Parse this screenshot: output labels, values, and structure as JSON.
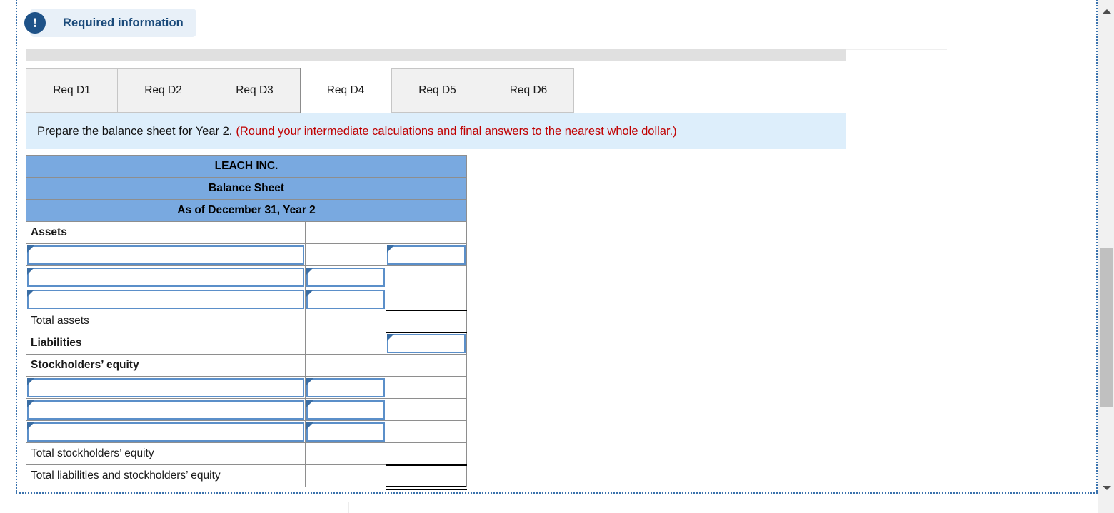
{
  "notice": {
    "icon": "exclamation-icon",
    "icon_glyph": "!",
    "label": "Required information"
  },
  "tabs": [
    {
      "label": "Req D1",
      "active": false
    },
    {
      "label": "Req D2",
      "active": false
    },
    {
      "label": "Req D3",
      "active": false
    },
    {
      "label": "Req D4",
      "active": true
    },
    {
      "label": "Req D5",
      "active": false
    },
    {
      "label": "Req D6",
      "active": false
    }
  ],
  "prompt": {
    "text": "Prepare the balance sheet for Year 2.",
    "note": "(Round your intermediate calculations and final answers to the nearest whole dollar.)",
    "note_color": "#c00000",
    "background": "#ddeefb"
  },
  "statement": {
    "header_background": "#79a9e0",
    "title_lines": [
      "LEACH INC.",
      "Balance Sheet",
      "As of December 31, Year 2"
    ],
    "rows": [
      {
        "label": "Assets",
        "mid": "",
        "right": ""
      },
      {
        "label": "",
        "mid": "",
        "right": ""
      },
      {
        "label": "",
        "mid": "",
        "right": ""
      },
      {
        "label": "",
        "mid": "",
        "right": ""
      },
      {
        "label": "Total assets",
        "mid": "",
        "right": ""
      },
      {
        "label": "Liabilities",
        "mid": "",
        "right": ""
      },
      {
        "label": "Stockholders’ equity",
        "mid": "",
        "right": ""
      },
      {
        "label": "",
        "mid": "",
        "right": ""
      },
      {
        "label": "",
        "mid": "",
        "right": ""
      },
      {
        "label": "",
        "mid": "",
        "right": ""
      },
      {
        "label": "Total stockholders’ equity",
        "mid": "",
        "right": ""
      },
      {
        "label": "Total liabilities and stockholders’ equity",
        "mid": "",
        "right": ""
      }
    ],
    "input_placeholder": ""
  },
  "scrollbar": {
    "up_arrow": "scroll-up-icon",
    "down_arrow": "scroll-down-icon"
  }
}
